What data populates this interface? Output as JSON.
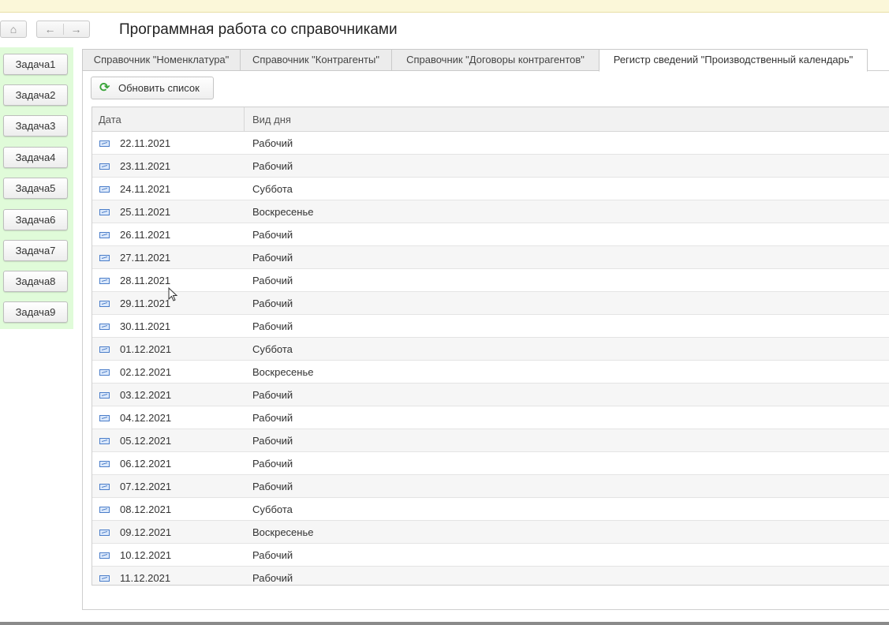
{
  "header": {
    "title": "Программная работа со справочниками",
    "home_glyph": "⌂",
    "back_glyph": "←",
    "forward_glyph": "→"
  },
  "sidebar": {
    "items": [
      {
        "label": "Задача1"
      },
      {
        "label": "Задача2"
      },
      {
        "label": "Задача3"
      },
      {
        "label": "Задача4"
      },
      {
        "label": "Задача5"
      },
      {
        "label": "Задача6"
      },
      {
        "label": "Задача7"
      },
      {
        "label": "Задача8"
      },
      {
        "label": "Задача9"
      }
    ]
  },
  "tabs": [
    {
      "label": "Справочник \"Номенклатура\""
    },
    {
      "label": "Справочник \"Контрагенты\""
    },
    {
      "label": "Справочник \"Договоры контрагентов\""
    },
    {
      "label": "Регистр сведений \"Производственный календарь\""
    }
  ],
  "toolbar": {
    "refresh_label": "Обновить список",
    "refresh_icon": "⟳"
  },
  "table": {
    "columns": [
      "Дата",
      "Вид дня"
    ],
    "rows": [
      {
        "date": "22.11.2021",
        "kind": "Рабочий"
      },
      {
        "date": "23.11.2021",
        "kind": "Рабочий"
      },
      {
        "date": "24.11.2021",
        "kind": "Суббота"
      },
      {
        "date": "25.11.2021",
        "kind": "Воскресенье"
      },
      {
        "date": "26.11.2021",
        "kind": "Рабочий"
      },
      {
        "date": "27.11.2021",
        "kind": "Рабочий"
      },
      {
        "date": "28.11.2021",
        "kind": "Рабочий"
      },
      {
        "date": "29.11.2021",
        "kind": "Рабочий"
      },
      {
        "date": "30.11.2021",
        "kind": "Рабочий"
      },
      {
        "date": "01.12.2021",
        "kind": "Суббота"
      },
      {
        "date": "02.12.2021",
        "kind": "Воскресенье"
      },
      {
        "date": "03.12.2021",
        "kind": "Рабочий"
      },
      {
        "date": "04.12.2021",
        "kind": "Рабочий"
      },
      {
        "date": "05.12.2021",
        "kind": "Рабочий"
      },
      {
        "date": "06.12.2021",
        "kind": "Рабочий"
      },
      {
        "date": "07.12.2021",
        "kind": "Рабочий"
      },
      {
        "date": "08.12.2021",
        "kind": "Суббота"
      },
      {
        "date": "09.12.2021",
        "kind": "Воскресенье"
      },
      {
        "date": "10.12.2021",
        "kind": "Рабочий"
      },
      {
        "date": "11.12.2021",
        "kind": "Рабочий"
      }
    ]
  }
}
